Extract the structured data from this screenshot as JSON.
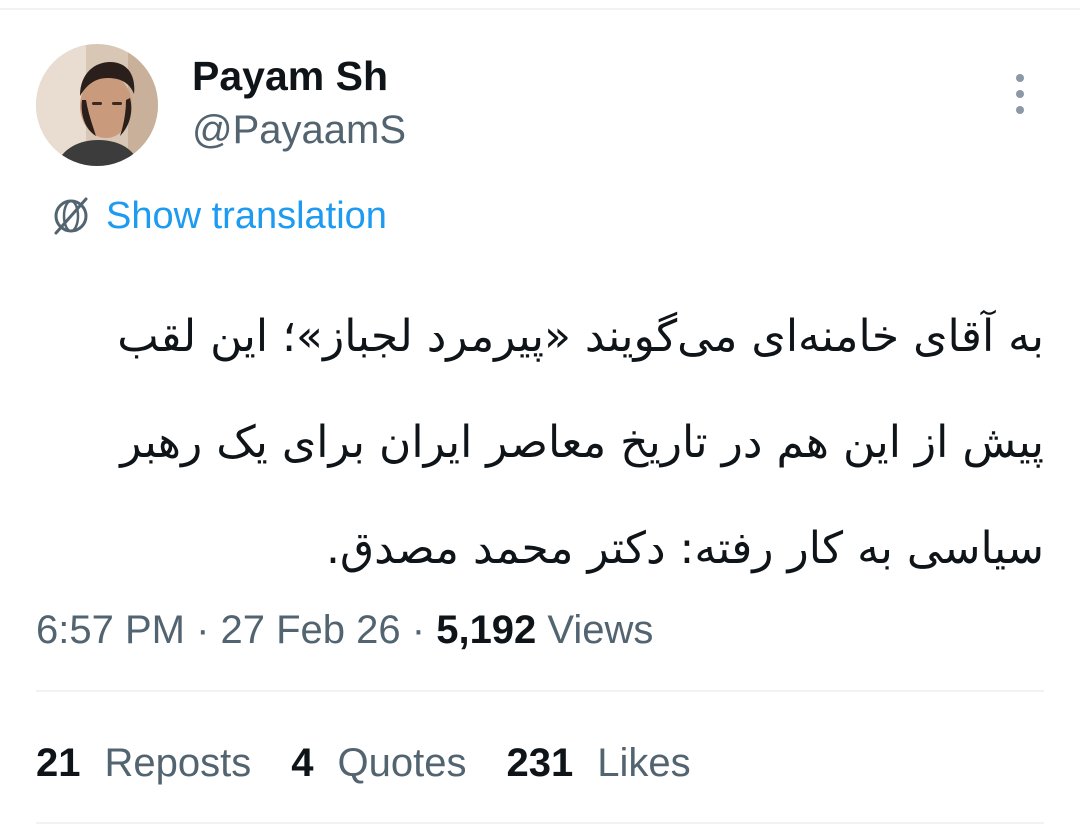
{
  "tweet": {
    "author": {
      "display_name": "Payam Sh",
      "handle": "@PayaamS"
    },
    "translate_label": "Show translation",
    "text_lines": [
      "به آقای خامنه‌ای می‌گویند «پیرمرد لجباز»؛ این لقب",
      "پیش از این هم در تاریخ معاصر ایران برای یک رهبر",
      "سیاسی به کار رفته: دکتر محمد مصدق."
    ],
    "meta": {
      "time": "6:57 PM",
      "sep1": " · ",
      "date": "27 Feb 26",
      "sep2": " · ",
      "views_count": "5,192",
      "views_label": " Views"
    },
    "stats": {
      "reposts": {
        "count": "21",
        "label": "Reposts"
      },
      "quotes": {
        "count": "4",
        "label": "Quotes"
      },
      "likes": {
        "count": "231",
        "label": "Likes"
      }
    }
  },
  "icons": {
    "more": "more-vertical-icon",
    "translate": "translate-globe-icon"
  },
  "colors": {
    "link": "#1d9bf0",
    "text_primary": "#0f1419",
    "text_secondary": "#536471",
    "divider": "#eff3f4"
  }
}
